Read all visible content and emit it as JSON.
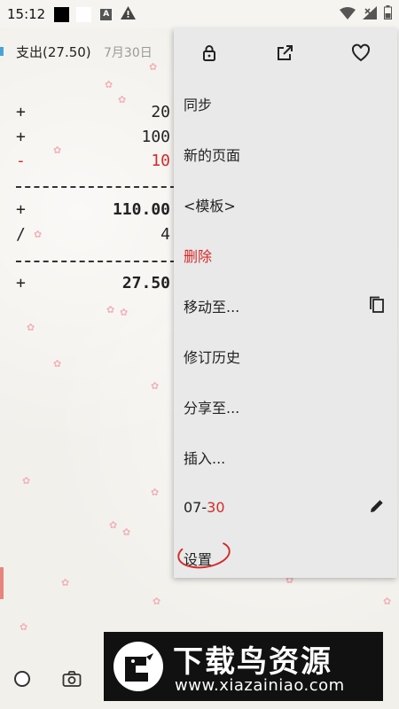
{
  "status_bar": {
    "time": "15:12",
    "icons": [
      "black-square-icon",
      "white-square-icon",
      "a-badge-icon",
      "warning-icon",
      "wifi-icon",
      "signal-x-icon",
      "battery-icon"
    ]
  },
  "header": {
    "title": "支出(27.50)",
    "date": "7月30日"
  },
  "calc": {
    "rows": [
      {
        "op": "+",
        "value": "20"
      },
      {
        "op": "+",
        "value": "100"
      },
      {
        "op": "-",
        "value": "10"
      },
      {
        "op": "+",
        "value": "110.00"
      },
      {
        "op": "/",
        "value": "4"
      },
      {
        "op": "+",
        "value": "27.50"
      }
    ],
    "dashes": "--------------"
  },
  "menu": {
    "top_icons": [
      "lock-icon",
      "open-external-icon",
      "heart-icon"
    ],
    "items": {
      "sync": "同步",
      "new_page": "新的页面",
      "template": "<模板>",
      "delete": "删除",
      "move_to": "移动至...",
      "history": "修订历史",
      "share_to": "分享至...",
      "insert": "插入...",
      "date_month": "07-",
      "date_day": "30",
      "settings": "设置"
    }
  },
  "watermark": {
    "title": "下载鸟资源",
    "url": "www.xiazainiao.com"
  },
  "colors": {
    "accent_blue": "#49a3d8",
    "red": "#d32b2b",
    "menu_bg": "#e9e9e9",
    "blossom": "#f1b2b8"
  }
}
